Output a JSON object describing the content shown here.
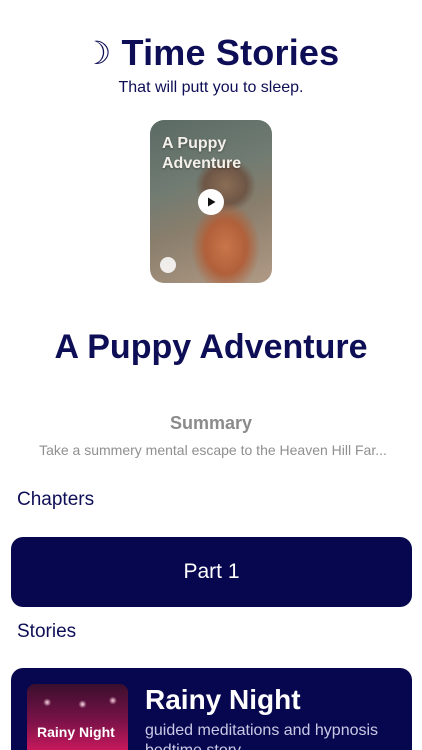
{
  "header": {
    "moon_icon": "☽",
    "title": "Time Stories",
    "subtitle": "That will putt you to sleep."
  },
  "featured": {
    "cover_title": "A Puppy Adventure",
    "title": "A Puppy Adventure",
    "summary_heading": "Summary",
    "summary_text": "Take a summery mental escape to the Heaven Hill Far..."
  },
  "chapters": {
    "label": "Chapters",
    "items": [
      {
        "label": "Part 1"
      }
    ]
  },
  "stories": {
    "label": "Stories",
    "items": [
      {
        "thumb_label": "Rainy Night",
        "title": "Rainy Night",
        "description": "guided meditations and hypnosis bedtime story"
      }
    ]
  },
  "colors": {
    "primary": "#07074f",
    "title_text": "#0e0e57",
    "muted_text": "#8f8f8f"
  },
  "icons": {
    "moon": "moon-icon",
    "play": "play-icon",
    "info": "info-icon"
  }
}
